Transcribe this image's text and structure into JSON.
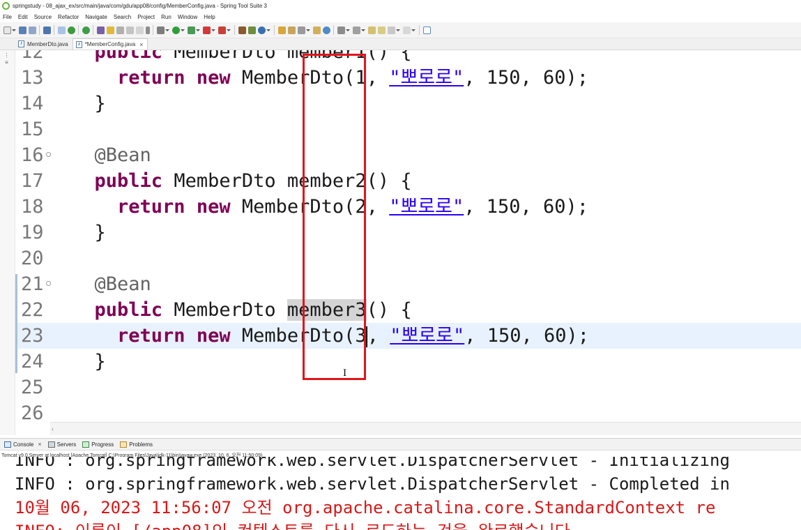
{
  "window": {
    "title": "springstudy - 08_ajax_ex/src/main/java/com/gdu/app08/config/MemberConfig.java - Spring Tool Suite 3"
  },
  "menu": [
    "File",
    "Edit",
    "Source",
    "Refactor",
    "Navigate",
    "Search",
    "Project",
    "Run",
    "Window",
    "Help"
  ],
  "tabs": [
    {
      "label": "MemberDto.java",
      "active": false
    },
    {
      "label": "*MemberConfig.java",
      "active": true,
      "close": "×"
    }
  ],
  "editor": {
    "current_line": 23,
    "lines": [
      {
        "n": "12",
        "fold": false,
        "parts": [
          {
            "t": "  "
          },
          {
            "c": "kw",
            "t": "public"
          },
          {
            "t": " MemberDto member1() {"
          }
        ]
      },
      {
        "n": "13",
        "fold": false,
        "parts": [
          {
            "t": "    "
          },
          {
            "c": "kw",
            "t": "return"
          },
          {
            "t": " "
          },
          {
            "c": "kw",
            "t": "new"
          },
          {
            "t": " MemberDto(1, "
          },
          {
            "c": "str",
            "t": "\"뽀로로\""
          },
          {
            "t": ", 150, 60);"
          }
        ]
      },
      {
        "n": "14",
        "fold": false,
        "parts": [
          {
            "t": "  }"
          }
        ]
      },
      {
        "n": "15",
        "fold": false,
        "parts": []
      },
      {
        "n": "16",
        "fold": true,
        "parts": [
          {
            "t": "  "
          },
          {
            "c": "ann",
            "t": "@Bean"
          }
        ]
      },
      {
        "n": "17",
        "fold": false,
        "parts": [
          {
            "t": "  "
          },
          {
            "c": "kw",
            "t": "public"
          },
          {
            "t": " MemberDto member2() {"
          }
        ]
      },
      {
        "n": "18",
        "fold": false,
        "parts": [
          {
            "t": "    "
          },
          {
            "c": "kw",
            "t": "return"
          },
          {
            "t": " "
          },
          {
            "c": "kw",
            "t": "new"
          },
          {
            "t": " MemberDto(2, "
          },
          {
            "c": "str",
            "t": "\"뽀로로\""
          },
          {
            "t": ", 150, 60);"
          }
        ]
      },
      {
        "n": "19",
        "fold": false,
        "parts": [
          {
            "t": "  }"
          }
        ]
      },
      {
        "n": "20",
        "fold": false,
        "parts": []
      },
      {
        "n": "21",
        "fold": true,
        "parts": [
          {
            "t": "  "
          },
          {
            "c": "ann",
            "t": "@Bean"
          }
        ]
      },
      {
        "n": "22",
        "fold": false,
        "parts": [
          {
            "t": "  "
          },
          {
            "c": "kw",
            "t": "public"
          },
          {
            "t": " MemberDto "
          },
          {
            "c": "sel-occ",
            "t": "member3"
          },
          {
            "t": "() {"
          }
        ]
      },
      {
        "n": "23",
        "fold": false,
        "parts": [
          {
            "t": "    "
          },
          {
            "c": "kw",
            "t": "return"
          },
          {
            "t": " "
          },
          {
            "c": "kw",
            "t": "new"
          },
          {
            "t": " MemberDto(3"
          },
          {
            "c": "caret",
            "t": ""
          },
          {
            "t": ", "
          },
          {
            "c": "str",
            "t": "\"뽀로로\""
          },
          {
            "t": ", 150, 60);"
          }
        ]
      },
      {
        "n": "24",
        "fold": false,
        "parts": [
          {
            "t": "  }"
          }
        ]
      },
      {
        "n": "25",
        "fold": false,
        "parts": []
      },
      {
        "n": "26",
        "fold": false,
        "parts": []
      }
    ]
  },
  "console": {
    "tabs": [
      {
        "label": "Console",
        "close": "×"
      },
      {
        "label": "Servers"
      },
      {
        "label": "Progress"
      },
      {
        "label": "Problems"
      }
    ],
    "info": "Tomcat v9.0 Server at localhost [Apache Tomcat] C:\\Program Files\\Java\\jdk-11\\bin\\javaw.exe  (2023. 10. 6. 오전 11:50:09)",
    "lines": [
      {
        "color": "black",
        "text": "INFO : org.springframework.web.servlet.DispatcherServlet - Initializing"
      },
      {
        "color": "black",
        "text": "INFO : org.springframework.web.servlet.DispatcherServlet - Completed in"
      },
      {
        "color": "red",
        "text": "10월 06, 2023 11:56:07 오전 org.apache.catalina.core.StandardContext re"
      },
      {
        "color": "red",
        "text": "INFO: 이름이 [/app08]인 컨텍스트를 다시 로드하는 것을 완료했습니다."
      }
    ]
  },
  "colors": {
    "keyword": "#7f0055",
    "annotation": "#646464",
    "string": "#2a00ff",
    "current_line": "#e8f2fe",
    "highlight_box": "#e0151a",
    "console_error": "#d81818"
  }
}
